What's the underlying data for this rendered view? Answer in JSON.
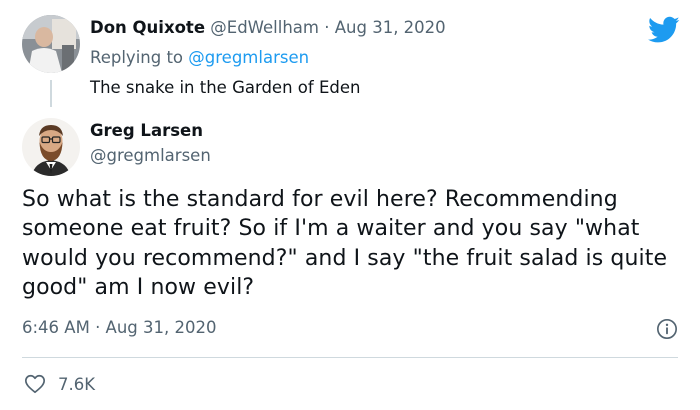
{
  "colors": {
    "accent": "#1d9bf0",
    "text_primary": "#0f1419",
    "text_secondary": "#536471",
    "divider": "#cfd9de"
  },
  "reply_tweet": {
    "author_name": "Don Quixote",
    "author_handle": "@EdWellham",
    "separator": "·",
    "date": "Aug 31, 2020",
    "replying_prefix": "Replying to",
    "replying_to": "@gregmlarsen",
    "text": "The snake in the Garden of Eden",
    "avatar_icon": "profile-photo-man"
  },
  "main_tweet": {
    "author_name": "Greg Larsen",
    "author_handle": "@gregmlarsen",
    "text": "So what is the standard for evil here? Recommending someone eat fruit? So if I'm a waiter and you say \"what would you recommend?\" and I say \"the fruit salad is quite good\" am I now evil?",
    "timestamp": "6:46 AM · Aug 31, 2020",
    "likes": "7.6K",
    "avatar_icon": "profile-photo-bearded-man"
  },
  "icons": {
    "brand": "twitter-bird-icon",
    "info": "info-icon",
    "like": "heart-icon"
  }
}
